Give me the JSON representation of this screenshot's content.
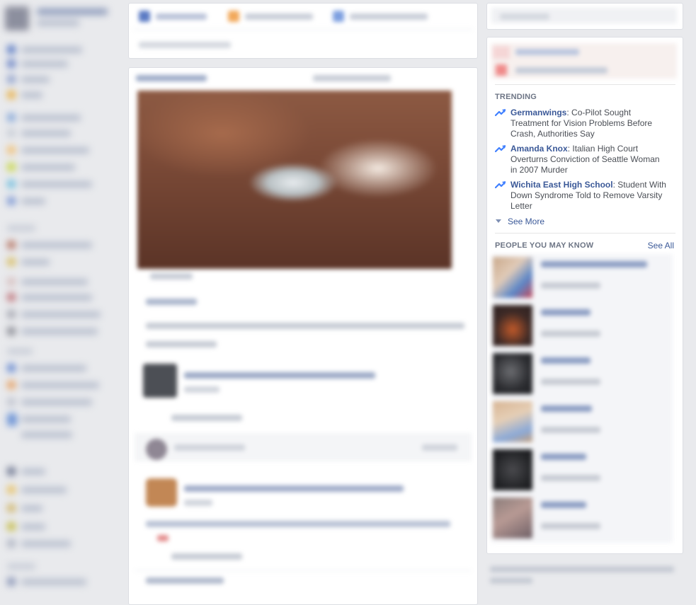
{
  "trending": {
    "title": "TRENDING",
    "items": [
      {
        "topic": "Germanwings",
        "headline": ": Co-Pilot Sought Treatment for Vision Problems Before Crash, Authorities Say"
      },
      {
        "topic": "Amanda Knox",
        "headline": ": Italian High Court Overturns Conviction of Seattle Woman in 2007 Murder"
      },
      {
        "topic": "Wichita East High School",
        "headline": ": Student With Down Syndrome Told to Remove Varsity Letter"
      }
    ],
    "see_more": "See More"
  },
  "people_you_may_know": {
    "title": "PEOPLE YOU MAY KNOW",
    "see_all": "See All",
    "count": 6
  },
  "colors": {
    "link_blue": "#3b5998",
    "section_gray": "#6d7585",
    "page_bg": "#e9eaed",
    "trend_icon": "#4080ff"
  },
  "icons": {
    "trend": "trending-up-arrow-icon",
    "see_more": "triangle-down-icon"
  }
}
